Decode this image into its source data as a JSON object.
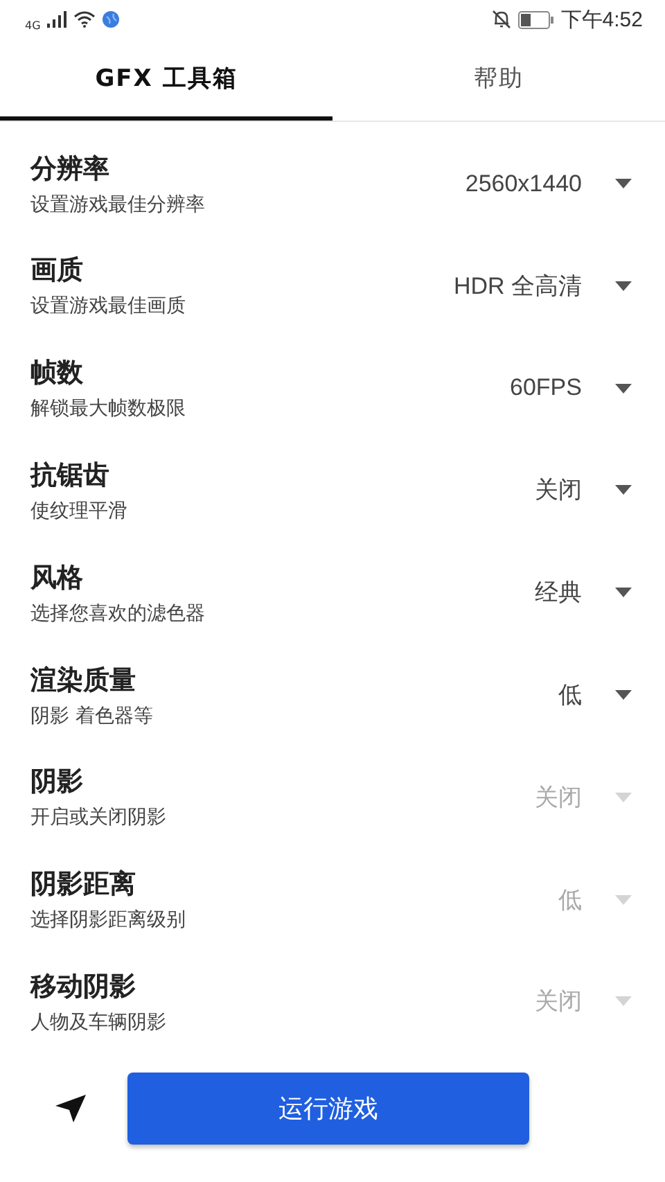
{
  "status_bar": {
    "network": "4G",
    "time": "下午4:52"
  },
  "tabs": [
    {
      "label": "GFX 工具箱",
      "selected": true
    },
    {
      "label": "帮助",
      "selected": false
    }
  ],
  "settings": [
    {
      "title": "分辨率",
      "subtitle": "设置游戏最佳分辨率",
      "value": "2560x1440",
      "disabled": false
    },
    {
      "title": "画质",
      "subtitle": "设置游戏最佳画质",
      "value": "HDR 全高清",
      "disabled": false
    },
    {
      "title": "帧数",
      "subtitle": "解锁最大帧数极限",
      "value": "60FPS",
      "disabled": false
    },
    {
      "title": "抗锯齿",
      "subtitle": "使纹理平滑",
      "value": "关闭",
      "disabled": false
    },
    {
      "title": "风格",
      "subtitle": "选择您喜欢的滤色器",
      "value": "经典",
      "disabled": false
    },
    {
      "title": "渲染质量",
      "subtitle": "阴影 着色器等",
      "value": "低",
      "disabled": false
    },
    {
      "title": "阴影",
      "subtitle": "开启或关闭阴影",
      "value": "关闭",
      "disabled": true
    },
    {
      "title": "阴影距离",
      "subtitle": "选择阴影距离级别",
      "value": "低",
      "disabled": true
    },
    {
      "title": "移动阴影",
      "subtitle": "人物及车辆阴影",
      "value": "关闭",
      "disabled": true
    }
  ],
  "run_button": "运行游戏"
}
